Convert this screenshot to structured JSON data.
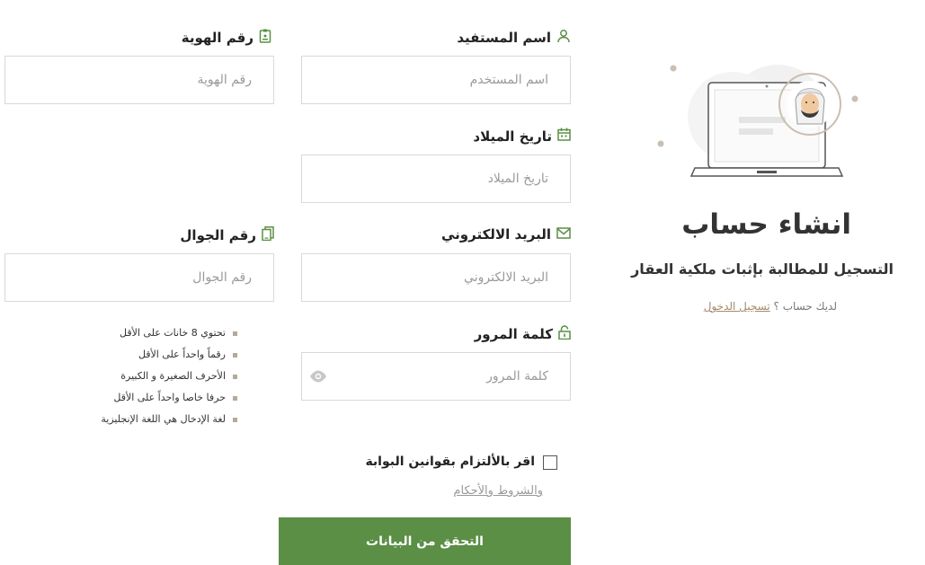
{
  "side": {
    "title": "انشاء حساب",
    "subtitle": "التسجيل للمطالبة بإثبات ملكية العقار",
    "have_account": "لديك حساب ؟",
    "login_link": "تسجيل الدخول"
  },
  "form": {
    "username": {
      "label": "اسم المستفيد",
      "placeholder": "اسم المستخدم",
      "icon": "user-icon"
    },
    "national_id": {
      "label": "رقم الهوية",
      "placeholder": "رقم الهوية",
      "icon": "id-card-icon"
    },
    "birthdate": {
      "label": "تاريخ الميلاد",
      "placeholder": "تاريخ الميلاد",
      "icon": "calendar-icon"
    },
    "email": {
      "label": "البريد الالكتروني",
      "placeholder": "البريد الالكتروني",
      "icon": "envelope-icon"
    },
    "mobile": {
      "label": "رقم الجوال",
      "placeholder": "رقم الجوال",
      "icon": "phone-icon"
    },
    "password": {
      "label": "كلمة المرور",
      "placeholder": "كلمة المرور",
      "icon": "lock-icon"
    }
  },
  "password_rules": [
    "تحتوي 8 خانات على الأقل",
    "رقماً واحداً على الأقل",
    "الأحرف الصغيرة و الكبيرة",
    "حرفا خاصا واحداً على الأقل",
    "لغة الإدخال هي اللغة الإنجليزية"
  ],
  "agreement": {
    "label": "اقر بالألتزام بقوانين البوابة",
    "terms_link": "والشروط والأحكام",
    "checked": false
  },
  "submit_label": "التحقق من البيانات",
  "colors": {
    "primary": "#5a8f45",
    "accent": "#b4a99a"
  }
}
